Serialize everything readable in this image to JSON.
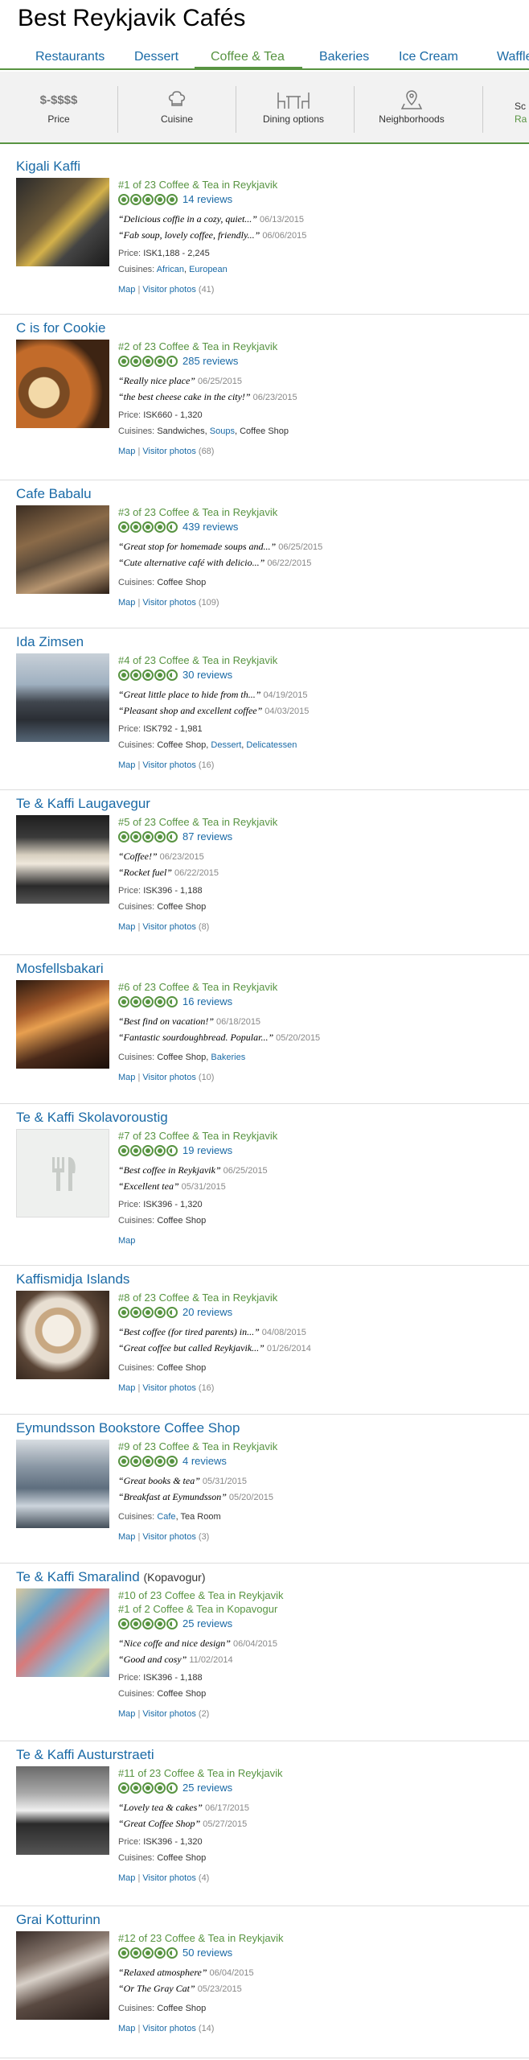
{
  "page_title": "Best Reykjavik Cafés",
  "tabs": [
    {
      "label": "Restaurants"
    },
    {
      "label": "Dessert"
    },
    {
      "label": "Coffee & Tea"
    },
    {
      "label": "Bakeries"
    },
    {
      "label": "Ice Cream"
    },
    {
      "label": "Waffle"
    }
  ],
  "filters": [
    {
      "label": "Price",
      "icon": "price-icon",
      "icon_text": "$-$$$$"
    },
    {
      "label": "Cuisine",
      "icon": "chef-hat-icon"
    },
    {
      "label": "Dining options",
      "icon": "table-chairs-icon"
    },
    {
      "label": "Neighborhoods",
      "icon": "map-pin-icon"
    },
    {
      "label_top": "Sc",
      "label": "Ra"
    }
  ],
  "listings": [
    {
      "name": "Kigali Kaffi",
      "rank": "#1 of 23 Coffee & Tea in Reykjavik",
      "rating": 5,
      "reviews": "14 reviews",
      "quotes": [
        {
          "text": "“Delicious coffie in a cozy, quiet...”",
          "date": "06/13/2015"
        },
        {
          "text": "“Fab soup, lovely coffee, friendly...”",
          "date": "06/06/2015"
        }
      ],
      "price": "ISK1,188 - 2,245",
      "cuisines": [
        {
          "t": "African",
          "link": true
        },
        {
          "t": ", ",
          "link": false
        },
        {
          "t": "European",
          "link": true
        }
      ],
      "photos": "Visitor photos",
      "photos_count": "(41)"
    },
    {
      "name": "C is for Cookie",
      "rank": "#2 of 23 Coffee & Tea in Reykjavik",
      "rating": 4.5,
      "reviews": "285 reviews",
      "quotes": [
        {
          "text": "“Really nice place”",
          "date": "06/25/2015"
        },
        {
          "text": "“the best cheese cake in the city!”",
          "date": "06/23/2015"
        }
      ],
      "price": "ISK660 - 1,320",
      "cuisines": [
        {
          "t": "Sandwiches, ",
          "link": false
        },
        {
          "t": "Soups",
          "link": true
        },
        {
          "t": ", Coffee Shop",
          "link": false
        }
      ],
      "photos": "Visitor photos",
      "photos_count": "(68)"
    },
    {
      "name": "Cafe Babalu",
      "rank": "#3 of 23 Coffee & Tea in Reykjavik",
      "rating": 4.5,
      "reviews": "439 reviews",
      "quotes": [
        {
          "text": "“Great stop for homemade soups and...”",
          "date": "06/25/2015"
        },
        {
          "text": "“Cute alternative café with delicio...”",
          "date": "06/22/2015"
        }
      ],
      "price": "",
      "cuisines": [
        {
          "t": "Coffee Shop",
          "link": false
        }
      ],
      "photos": "Visitor photos",
      "photos_count": "(109)"
    },
    {
      "name": "Ida Zimsen",
      "rank": "#4 of 23 Coffee & Tea in Reykjavik",
      "rating": 4.5,
      "reviews": "30 reviews",
      "quotes": [
        {
          "text": "“Great little place to hide from th...”",
          "date": "04/19/2015"
        },
        {
          "text": "“Pleasant shop and excellent coffee”",
          "date": "04/03/2015"
        }
      ],
      "price": "ISK792 - 1,981",
      "cuisines": [
        {
          "t": "Coffee Shop, ",
          "link": false
        },
        {
          "t": "Dessert",
          "link": true
        },
        {
          "t": ", ",
          "link": false
        },
        {
          "t": "Delicatessen",
          "link": true
        }
      ],
      "photos": "Visitor photos",
      "photos_count": "(16)"
    },
    {
      "name": "Te & Kaffi Laugavegur",
      "rank": "#5 of 23 Coffee & Tea in Reykjavik",
      "rating": 4.5,
      "reviews": "87 reviews",
      "quotes": [
        {
          "text": "“Coffee!”",
          "date": "06/23/2015"
        },
        {
          "text": "“Rocket fuel”",
          "date": "06/22/2015"
        }
      ],
      "price": "ISK396 - 1,188",
      "cuisines": [
        {
          "t": "Coffee Shop",
          "link": false
        }
      ],
      "photos": "Visitor photos",
      "photos_count": "(8)"
    },
    {
      "name": "Mosfellsbakari",
      "rank": "#6 of 23 Coffee & Tea in Reykjavik",
      "rating": 4.5,
      "reviews": "16 reviews",
      "quotes": [
        {
          "text": "“Best find on vacation!”",
          "date": "06/18/2015"
        },
        {
          "text": "“Fantastic sourdoughbread. Popular...”",
          "date": "05/20/2015"
        }
      ],
      "price": "",
      "cuisines": [
        {
          "t": "Coffee Shop, ",
          "link": false
        },
        {
          "t": "Bakeries",
          "link": true
        }
      ],
      "photos": "Visitor photos",
      "photos_count": "(10)"
    },
    {
      "name": "Te & Kaffi Skolavoroustig",
      "rank": "#7 of 23 Coffee & Tea in Reykjavik",
      "rating": 4.5,
      "reviews": "19 reviews",
      "quotes": [
        {
          "text": "“Best coffee in Reykjavik”",
          "date": "06/25/2015"
        },
        {
          "text": "“Excellent tea”",
          "date": "05/31/2015"
        }
      ],
      "price": "ISK396 - 1,320",
      "cuisines": [
        {
          "t": "Coffee Shop",
          "link": false
        }
      ],
      "photos": "",
      "photos_count": ""
    },
    {
      "name": "Kaffismidja Islands",
      "rank": "#8 of 23 Coffee & Tea in Reykjavik",
      "rating": 4.5,
      "reviews": "20 reviews",
      "quotes": [
        {
          "text": "“Best coffee (for tired parents) in...”",
          "date": "04/08/2015"
        },
        {
          "text": "“Great coffee but called Reykjavik...”",
          "date": "01/26/2014"
        }
      ],
      "price": "",
      "cuisines": [
        {
          "t": "Coffee Shop",
          "link": false
        }
      ],
      "photos": "Visitor photos",
      "photos_count": "(16)"
    },
    {
      "name": "Eymundsson Bookstore Coffee Shop",
      "rank": "#9 of 23 Coffee & Tea in Reykjavik",
      "rating": 5,
      "reviews": "4 reviews",
      "quotes": [
        {
          "text": "“Great books & tea”",
          "date": "05/31/2015"
        },
        {
          "text": "“Breakfast at Eymundsson”",
          "date": "05/20/2015"
        }
      ],
      "price": "",
      "cuisines": [
        {
          "t": "Cafe",
          "link": true
        },
        {
          "t": ", Tea Room",
          "link": false
        }
      ],
      "photos": "Visitor photos",
      "photos_count": "(3)"
    },
    {
      "name": "Te & Kaffi Smaralind",
      "name_extra": "(Kopavogur)",
      "rank": "#10 of 23 Coffee & Tea in Reykjavik",
      "rank2": "#1 of 2 Coffee & Tea in Kopavogur",
      "rating": 4.5,
      "reviews": "25 reviews",
      "quotes": [
        {
          "text": "“Nice coffe and nice design”",
          "date": "06/04/2015"
        },
        {
          "text": "“Good and cosy”",
          "date": "11/02/2014"
        }
      ],
      "price": "ISK396 - 1,188",
      "cuisines": [
        {
          "t": "Coffee Shop",
          "link": false
        }
      ],
      "photos": "Visitor photos",
      "photos_count": "(2)"
    },
    {
      "name": "Te & Kaffi Austurstraeti",
      "rank": "#11 of 23 Coffee & Tea in Reykjavik",
      "rating": 4.5,
      "reviews": "25 reviews",
      "quotes": [
        {
          "text": "“Lovely tea & cakes”",
          "date": "06/17/2015"
        },
        {
          "text": "“Great Coffee Shop”",
          "date": "05/27/2015"
        }
      ],
      "price": "ISK396 - 1,320",
      "cuisines": [
        {
          "t": "Coffee Shop",
          "link": false
        }
      ],
      "photos": "Visitor photos",
      "photos_count": "(4)"
    },
    {
      "name": "Grai Kotturinn",
      "rank": "#12 of 23 Coffee & Tea in Reykjavik",
      "rating": 4.5,
      "reviews": "50 reviews",
      "quotes": [
        {
          "text": "“Relaxed atmosphere”",
          "date": "06/04/2015"
        },
        {
          "text": "“Or The Gray Cat”",
          "date": "05/23/2015"
        }
      ],
      "price": "",
      "cuisines": [
        {
          "t": "Coffee Shop",
          "link": false
        }
      ],
      "photos": "Visitor photos",
      "photos_count": "(14)"
    }
  ],
  "labels": {
    "price": "Price:",
    "cuisines": "Cuisines:",
    "map": "Map",
    "sep": "|"
  },
  "colors": {
    "accent_green": "#589442",
    "link_blue": "#1a6aa6"
  }
}
